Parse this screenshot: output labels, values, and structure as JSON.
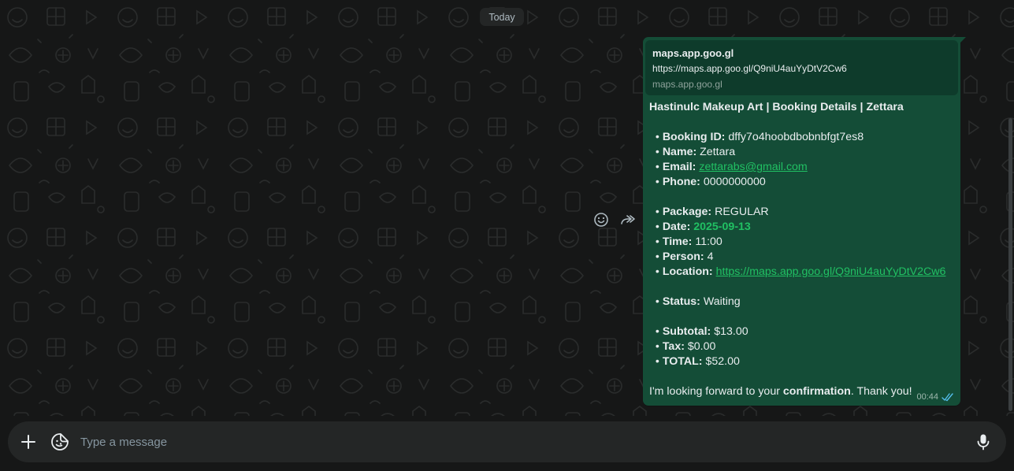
{
  "chat": {
    "date_chip": "Today"
  },
  "message": {
    "link_preview": {
      "title": "maps.app.goo.gl",
      "url": "https://maps.app.goo.gl/Q9niU4auYyDtV2Cw6",
      "domain": "maps.app.goo.gl"
    },
    "heading": "Hastinulc Makeup Art | Booking Details | Zettara",
    "fields": {
      "booking_id": {
        "label": "Booking ID:",
        "value": "dffy7o4hoobdbobnbfgt7es8"
      },
      "name": {
        "label": "Name:",
        "value": "Zettara"
      },
      "email": {
        "label": "Email:",
        "value": "zettarabs@gmail.com"
      },
      "phone": {
        "label": "Phone:",
        "value": "0000000000"
      },
      "package": {
        "label": "Package:",
        "value": "REGULAR"
      },
      "date": {
        "label": "Date:",
        "value": "2025-09-13"
      },
      "time": {
        "label": "Time:",
        "value": "11:00"
      },
      "person": {
        "label": "Person:",
        "value": "4"
      },
      "location": {
        "label": "Location:",
        "value": "https://maps.app.goo.gl/Q9niU4auYyDtV2Cw6"
      },
      "status": {
        "label": "Status:",
        "value": "Waiting"
      },
      "subtotal": {
        "label": "Subtotal:",
        "value": "$13.00"
      },
      "tax": {
        "label": "Tax:",
        "value": "$0.00"
      },
      "total": {
        "label": "TOTAL:",
        "value": "$52.00"
      }
    },
    "bullet": "•",
    "closing_pre": "I'm looking forward to your ",
    "closing_bold": "confirmation",
    "closing_post": ". Thank you!",
    "time": "00:44",
    "status_icon": "double-check-icon"
  },
  "hover_actions": {
    "emoji_icon": "emoji-icon",
    "forward_icon": "forward-icon"
  },
  "composer": {
    "placeholder": "Type a message",
    "attach_icon": "plus-icon",
    "sticker_icon": "sticker-icon",
    "mic_icon": "mic-icon"
  },
  "colors": {
    "background": "#161717",
    "bubble_outgoing": "#144d37",
    "link_preview_bg": "#0e3b2b",
    "accent_green": "#21c063",
    "composer_bg": "#242626"
  }
}
